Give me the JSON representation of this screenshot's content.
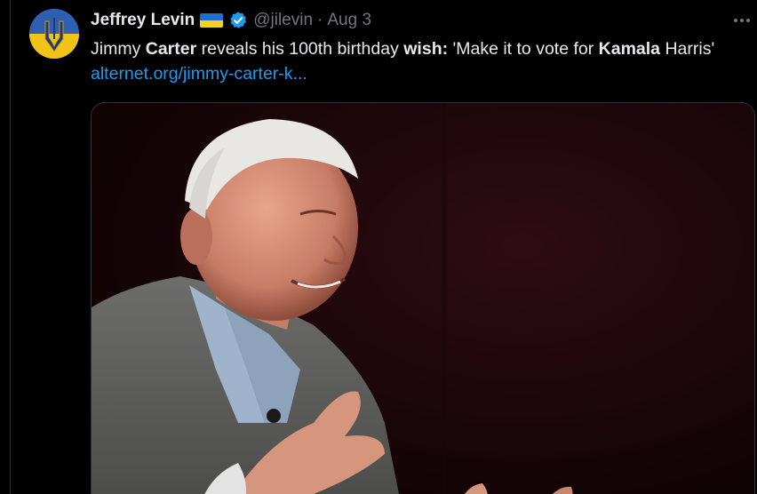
{
  "author": {
    "name": "Jeffrey Levin",
    "handle": "@jilevin",
    "separator": "·",
    "date": "Aug 3",
    "flag_icon": "ukraine-flag-icon",
    "verified_icon": "verified-badge-icon",
    "avatar_icon": "ukraine-trident-avatar",
    "verified_color": "#1d9bf0"
  },
  "tweet": {
    "t1": "Jimmy ",
    "b1": "Carter",
    "t2": " reveals his 100th birthday ",
    "b2": "wish:",
    "t3": " 'Make it to vote for ",
    "b3": "Kamala",
    "t4": " Harris' ",
    "link": "alternet.org/jimmy-carter-k..."
  },
  "media": {
    "description_icon": "photo-jimmy-carter-smiling"
  },
  "more_icon": "more-options-icon",
  "colors": {
    "background": "#000000",
    "text": "#e7e9ea",
    "muted": "#71767b",
    "link": "#1d9bf0"
  }
}
